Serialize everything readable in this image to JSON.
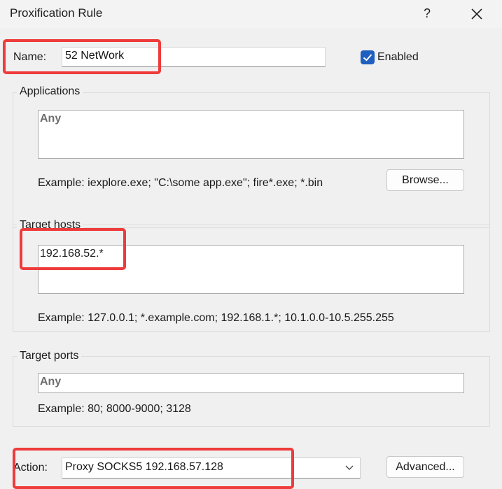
{
  "window": {
    "title": "Proxification Rule",
    "help_glyph": "?"
  },
  "name": {
    "label": "Name:",
    "value": "52 NetWork"
  },
  "enabled": {
    "label": "Enabled",
    "checked": true
  },
  "applications": {
    "group_title": "Applications",
    "value": "Any",
    "example": "Example: iexplore.exe; \"C:\\some app.exe\"; fire*.exe; *.bin",
    "browse_label": "Browse..."
  },
  "target_hosts": {
    "group_title": "Target hosts",
    "value": "192.168.52.*",
    "example": "Example: 127.0.0.1; *.example.com; 192.168.1.*; 10.1.0.0-10.5.255.255"
  },
  "target_ports": {
    "group_title": "Target ports",
    "value": "Any",
    "example": "Example: 80; 8000-9000; 3128"
  },
  "action": {
    "label": "Action:",
    "selected": "Proxy SOCKS5 192.168.57.128",
    "advanced_label": "Advanced..."
  },
  "colors": {
    "accent": "#1f5fbf",
    "highlight": "#ee3b3b"
  }
}
